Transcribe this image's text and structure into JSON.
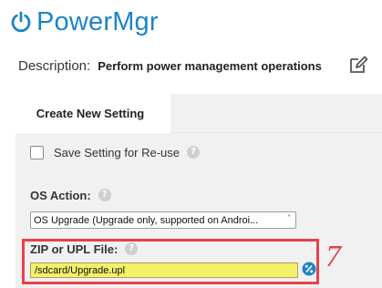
{
  "app": {
    "title": "PowerMgr",
    "brand_color": "#1d84c6",
    "logo_icon": "power-icon"
  },
  "description": {
    "label": "Description:",
    "value": "Perform power management operations",
    "edit_icon": "edit-icon"
  },
  "tabs": [
    {
      "label": "Create New Setting",
      "active": true
    }
  ],
  "form": {
    "save_setting": {
      "label": "Save Setting for Re-use",
      "checked": false,
      "help_icon": "help-icon"
    },
    "os_action": {
      "label": "OS Action:",
      "selected": "OS Upgrade (Upgrade only, supported on Androi...",
      "help_icon": "help-icon",
      "caret": "˅"
    },
    "zip_file": {
      "label": "ZIP or UPL File:",
      "value": "/sdcard/Upgrade.upl",
      "help_icon": "help-icon",
      "browse_icon": "percent-icon"
    }
  },
  "annotation": {
    "step_number": "7",
    "highlight_color": "#e8404a"
  },
  "colors": {
    "panel_bg": "#f1f1f1",
    "input_highlight": "#f4f06a"
  }
}
